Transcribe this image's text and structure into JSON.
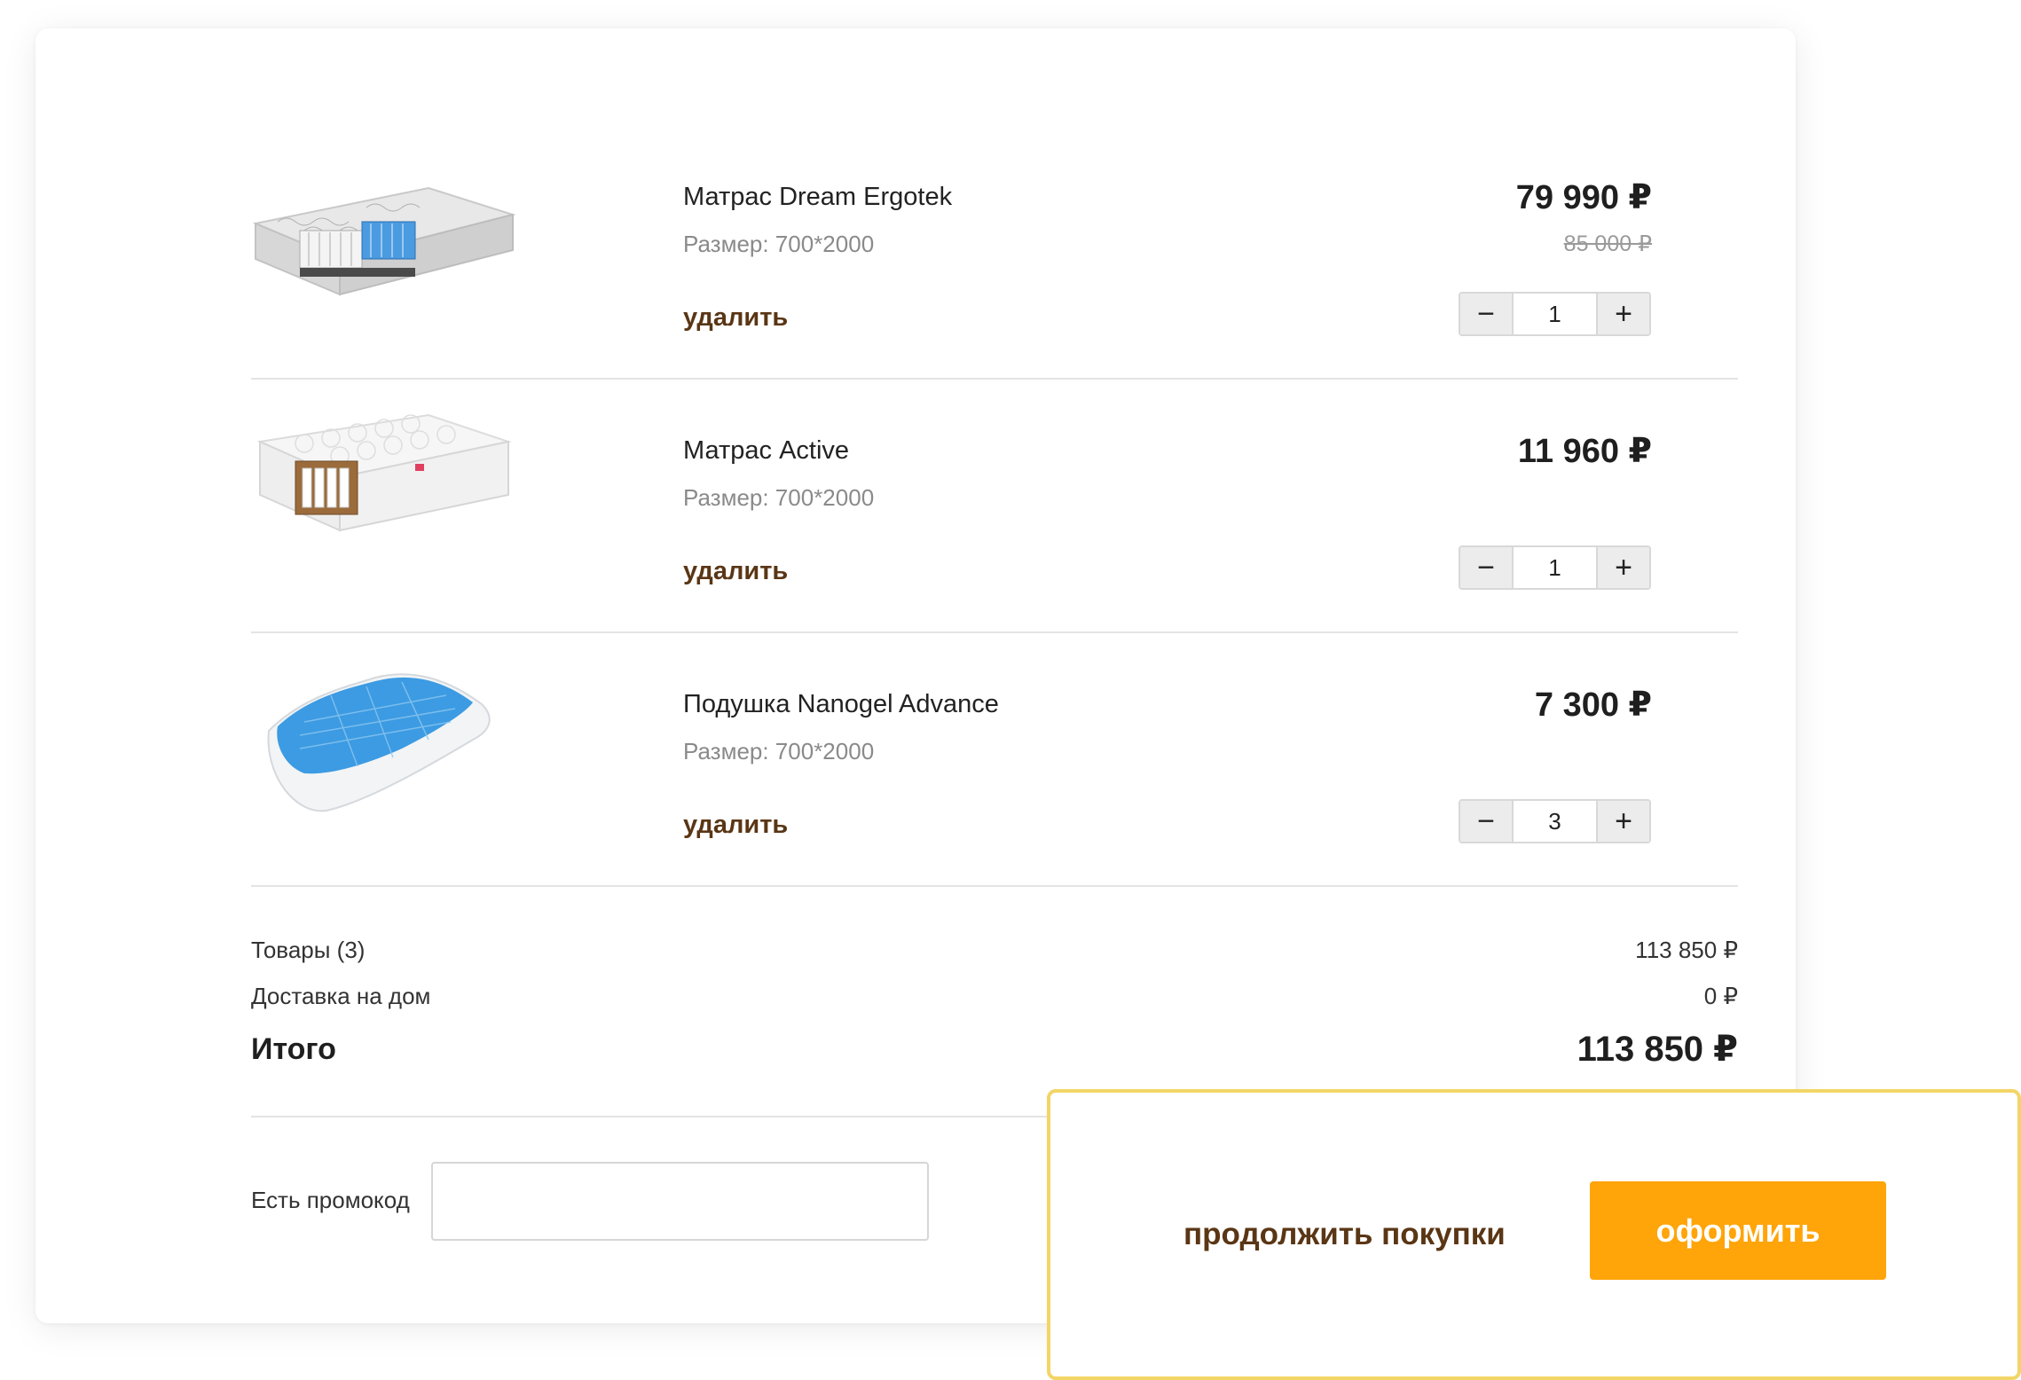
{
  "items": [
    {
      "name": "Матрас Dream Ergotek",
      "size": "Размер: 700*2000",
      "remove_label": "удалить",
      "price": "79 990 ₽",
      "old_price": "85 000 ₽",
      "quantity": "1",
      "image_icon": "mattress-image"
    },
    {
      "name": "Матрас Active",
      "size": "Размер: 700*2000",
      "remove_label": "удалить",
      "price": "11 960 ₽",
      "quantity": "1",
      "image_icon": "mattress-image"
    },
    {
      "name": "Подушка Nanogel Advance",
      "size": "Размер: 700*2000",
      "remove_label": "удалить",
      "price": "7 300 ₽",
      "quantity": "3",
      "image_icon": "pillow-image"
    }
  ],
  "stepper": {
    "minus": "−",
    "plus": "+"
  },
  "summary": {
    "goods_label": "Товары (3)",
    "goods_value": "113 850 ₽",
    "delivery_label": "Доставка на дом",
    "delivery_value": "0 ₽",
    "total_label": "Итого",
    "total_value": "113 850 ₽"
  },
  "promo": {
    "label": "Есть промокод",
    "value": "",
    "placeholder": ""
  },
  "actions": {
    "continue_label": "продолжить покупки",
    "checkout_label": "оформить"
  },
  "colors": {
    "accent": "#ffa409",
    "link": "#5a3615",
    "highlight_border": "#f3d567"
  }
}
